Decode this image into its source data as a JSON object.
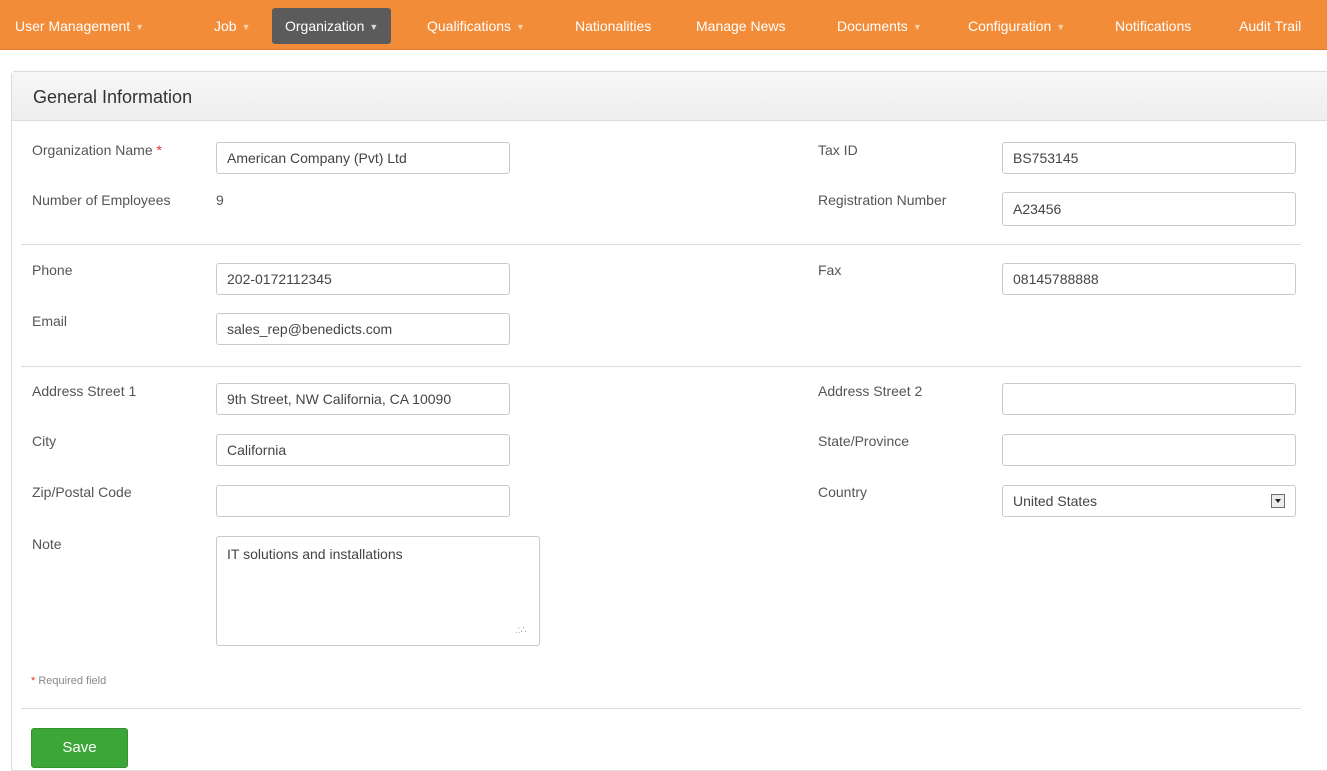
{
  "nav": {
    "items": [
      {
        "label": "User Management",
        "caret": "▼"
      },
      {
        "label": "Job",
        "caret": "▼"
      },
      {
        "label": "Organization",
        "caret": "▼"
      },
      {
        "label": "Qualifications",
        "caret": "▼"
      },
      {
        "label": "Nationalities",
        "caret": ""
      },
      {
        "label": "Manage News",
        "caret": ""
      },
      {
        "label": "Documents",
        "caret": "▼"
      },
      {
        "label": "Configuration",
        "caret": "▼"
      },
      {
        "label": "Notifications",
        "caret": ""
      },
      {
        "label": "Audit Trail",
        "caret": ""
      }
    ],
    "active": "Organization"
  },
  "panel": {
    "title": "General Information"
  },
  "form": {
    "org_name_label": "Organization Name",
    "required_star": "*",
    "org_name_value": "American Company (Pvt) Ltd",
    "employees_label": "Number of Employees",
    "employees_value": "9",
    "tax_id_label": "Tax ID",
    "tax_id_value": "BS753145",
    "reg_number_label": "Registration Number",
    "reg_number_value": "A23456",
    "phone_label": "Phone",
    "phone_value": "202-0172112345",
    "fax_label": "Fax",
    "fax_value": "08145788888",
    "email_label": "Email",
    "email_value": "sales_rep@benedicts.com",
    "address1_label": "Address Street 1",
    "address1_value": "9th Street, NW California, CA 10090",
    "address2_label": "Address Street 2",
    "address2_value": "",
    "city_label": "City",
    "city_value": "California",
    "state_label": "State/Province",
    "state_value": "",
    "zip_label": "Zip/Postal Code",
    "zip_value": "",
    "country_label": "Country",
    "country_value": "United States",
    "note_label": "Note",
    "note_value": "IT solutions and installations",
    "required_note": "Required field",
    "save_label": "Save"
  },
  "colors": {
    "nav_bg": "#f28c38",
    "nav_active_bg": "#5b5b5b",
    "save_bg": "#3da639",
    "required_star": "#e5322e"
  }
}
